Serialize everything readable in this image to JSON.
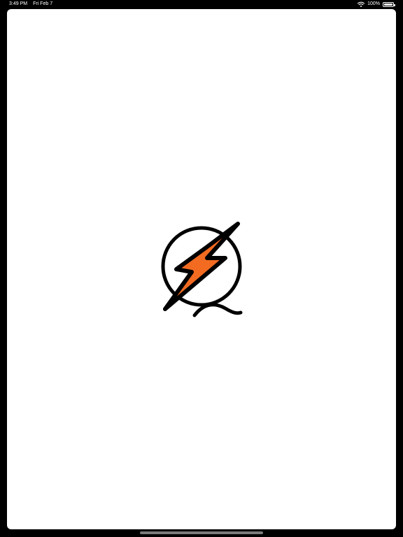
{
  "status_bar": {
    "time": "3:49 PM",
    "date": "Fri Feb 7",
    "battery": "100%",
    "wifi_icon": "wifi-icon",
    "battery_icon": "battery-icon"
  },
  "logo": {
    "icon": "lightning-bolt-q-logo",
    "colors": {
      "bolt_fill": "#F26B21",
      "outline": "#000000"
    }
  },
  "theme": {
    "background": "#000000",
    "sheet": "#FFFFFF"
  }
}
